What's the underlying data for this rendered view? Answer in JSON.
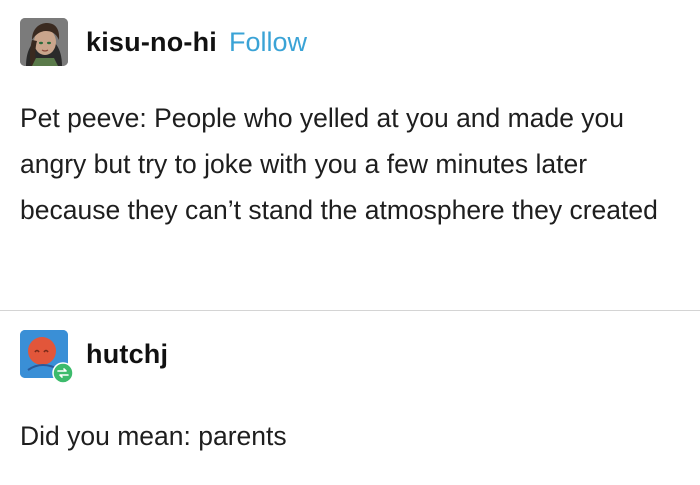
{
  "posts": [
    {
      "username": "kisu-no-hi",
      "follow_label": "Follow",
      "text": "Pet peeve: People who yelled at you and made you angry but try to joke with you a few minutes later because they can’t stand the atmosphere they created",
      "avatar_icon": "user-avatar-icon"
    },
    {
      "username": "hutchj",
      "text": "Did you mean: parents",
      "avatar_icon": "user-avatar-icon",
      "reblog_badge_icon": "reblog-icon",
      "colors": {
        "avatar_bg": "#3a8fd6",
        "avatar_circle": "#e2563a",
        "reblog_badge": "#3dbb6c"
      }
    }
  ],
  "colors": {
    "follow": "#3aa3d6",
    "divider": "#d4d4d4"
  }
}
